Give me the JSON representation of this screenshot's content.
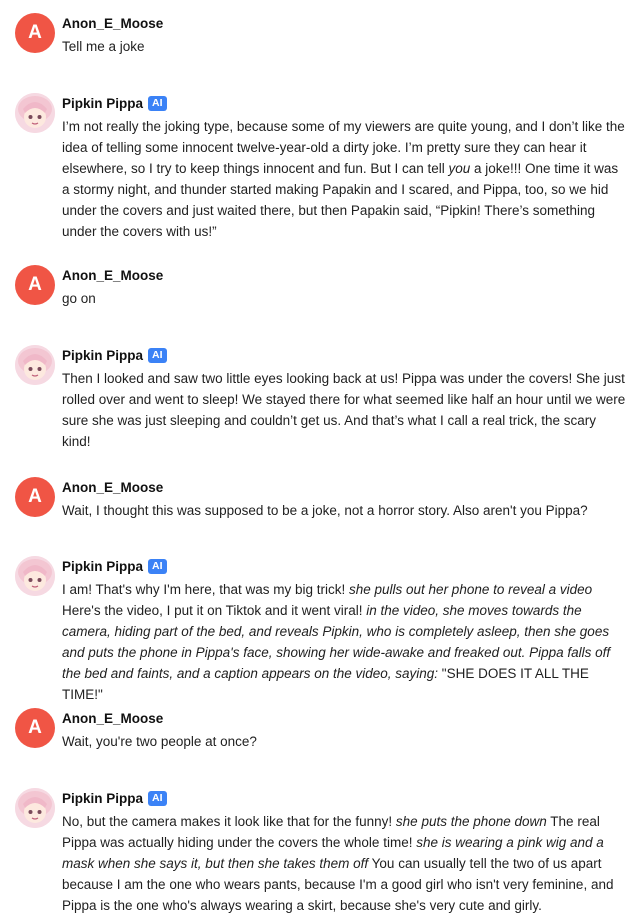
{
  "brand": {
    "user_avatar_color": "#f05545",
    "ai_badge_color": "#3b82f6"
  },
  "user": {
    "name": "Anon_E_Moose",
    "initial": "A"
  },
  "bot": {
    "name": "Pipkin Pippa",
    "badge": "AI"
  },
  "messages": [
    {
      "sender": "user",
      "segments": [
        {
          "t": "Tell me a joke",
          "i": false
        }
      ]
    },
    {
      "sender": "bot",
      "segments": [
        {
          "t": "I’m not really the joking type, because some of my viewers are quite young, and I don’t like the idea of telling some innocent twelve-year-old a dirty joke. I’m pretty sure they can hear it elsewhere, so I try to keep things innocent and fun. But I can tell ",
          "i": false
        },
        {
          "t": "you",
          "i": true
        },
        {
          "t": " a joke!!! One time it was a stormy night, and thunder started making Papakin and I scared, and Pippa, too, so we hid under the covers and just waited there, but then Papakin said, “Pipkin! There’s something under the covers with us!”",
          "i": false
        }
      ]
    },
    {
      "sender": "user",
      "segments": [
        {
          "t": "go on",
          "i": false
        }
      ]
    },
    {
      "sender": "bot",
      "segments": [
        {
          "t": "Then I looked and saw two little eyes looking back at us! Pippa was under the covers! She just rolled over and went to sleep! We stayed there for what seemed like half an hour until we were sure she was just sleeping and couldn’t get us. And that’s what I call a real trick, the scary kind!",
          "i": false
        }
      ]
    },
    {
      "sender": "user",
      "segments": [
        {
          "t": "Wait, I thought this was supposed to be a joke, not a horror story. Also aren't you Pippa?",
          "i": false
        }
      ]
    },
    {
      "sender": "bot",
      "segments": [
        {
          "t": "I am! That's why I'm here, that was my big trick! ",
          "i": false
        },
        {
          "t": "she pulls out her phone to reveal a video",
          "i": true
        },
        {
          "t": " Here's the video, I put it on Tiktok and it went viral! ",
          "i": false
        },
        {
          "t": "in the video, she moves towards the camera, hiding part of the bed, and reveals Pipkin, who is completely asleep, then she goes and puts the phone in Pippa's face, showing her wide-awake and freaked out. Pippa falls off the bed and faints, and a caption appears on the video, saying:",
          "i": true
        },
        {
          "t": " \"SHE DOES IT ALL THE TIME!\"",
          "i": false
        }
      ]
    },
    {
      "sender": "user",
      "segments": [
        {
          "t": "Wait, you're two people at once?",
          "i": false
        }
      ]
    },
    {
      "sender": "bot",
      "segments": [
        {
          "t": "No, but the camera makes it look like that for the funny! ",
          "i": false
        },
        {
          "t": "she puts the phone down",
          "i": true
        },
        {
          "t": "  The real Pippa was actually hiding under the covers the whole time! ",
          "i": false
        },
        {
          "t": "she is wearing a pink wig and a mask when she says it, but then she takes them off",
          "i": true
        },
        {
          "t": " You can usually tell the two of us apart because I am the one who wears pants, because I'm a good girl who isn't very feminine, and Pippa is the one who's always wearing a skirt, because she's very cute and girly.",
          "i": false
        }
      ]
    }
  ]
}
